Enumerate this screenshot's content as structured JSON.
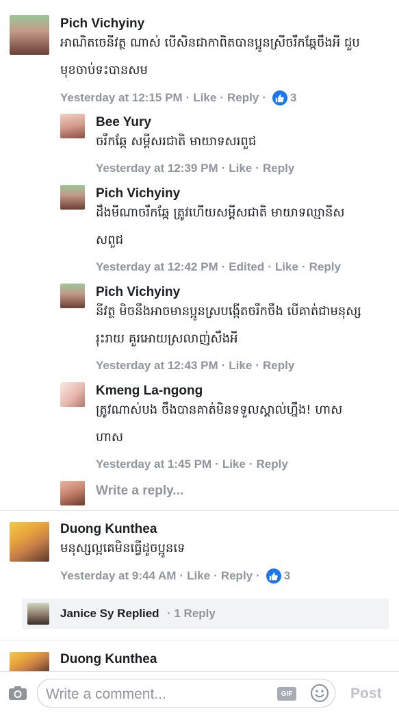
{
  "comments": {
    "c1": {
      "name": "Pich Vichyiny",
      "line1": "អាណិតចេនីវត្ថ ណាស់ បើសិនជាកាពិតបានប្អូនស្រីចរឹកឆ្កែចឹងអី ជួប",
      "line2": "មុខចាប់ទះបានសម",
      "time": "Yesterday at 12:15 PM",
      "like": "Like",
      "reply": "Reply",
      "likes": "3"
    },
    "r1": {
      "name": "Bee Yury",
      "line1": "ចរឹកឆ្កែ សម្ដីសរជាតិ មាយាទសរពួជ",
      "time": "Yesterday at 12:39 PM",
      "like": "Like",
      "reply": "Reply"
    },
    "r2": {
      "name": "Pich Vichyiny",
      "line1": "ដឹងមីណាចរឹកឆ្កែ ត្រូវហើយសម្ដីសជាតិ មាយាទឈ្មានីស",
      "line2": "សពួជ",
      "time": "Yesterday at 12:42 PM",
      "edited": "Edited",
      "like": "Like",
      "reply": "Reply"
    },
    "r3": {
      "name": "Pich Vichyiny",
      "line1": "នីវត្ថ មិចនឹងអាចមានប្អូនស្របង្កើតចរឹកចឹង បើគាត់ជាមនុស្ស",
      "line2": "រុះរាយ គួរអោយស្រលាញ់សឹងអី",
      "time": "Yesterday at 12:43 PM",
      "like": "Like",
      "reply": "Reply"
    },
    "r4": {
      "name": "Kmeng La-ngong",
      "line1": "ត្រូវណាស់បង ចឹងបានគាត់មិនទទួលស្គាល់ហ្នឹង! ហាស",
      "line2": "ហាស",
      "time": "Yesterday at 1:45 PM",
      "like": "Like",
      "reply": "Reply"
    },
    "c2": {
      "name": "Duong Kunthea",
      "line1": "មនុស្សល្អគេមិនធ្វើដូចប្អូនទេ",
      "time": "Yesterday at 9:44 AM",
      "like": "Like",
      "reply": "Reply",
      "likes": "3"
    },
    "c3": {
      "name": "Duong Kunthea"
    }
  },
  "write_reply": "Write a reply...",
  "replied": {
    "name": "Janice Sy Replied",
    "count": "· 1 Reply"
  },
  "composer": {
    "placeholder": "Write a comment...",
    "gif": "GIF",
    "post": "Post"
  },
  "colors": {
    "like_blue": "#1877f2",
    "meta_gray": "#90949c"
  }
}
